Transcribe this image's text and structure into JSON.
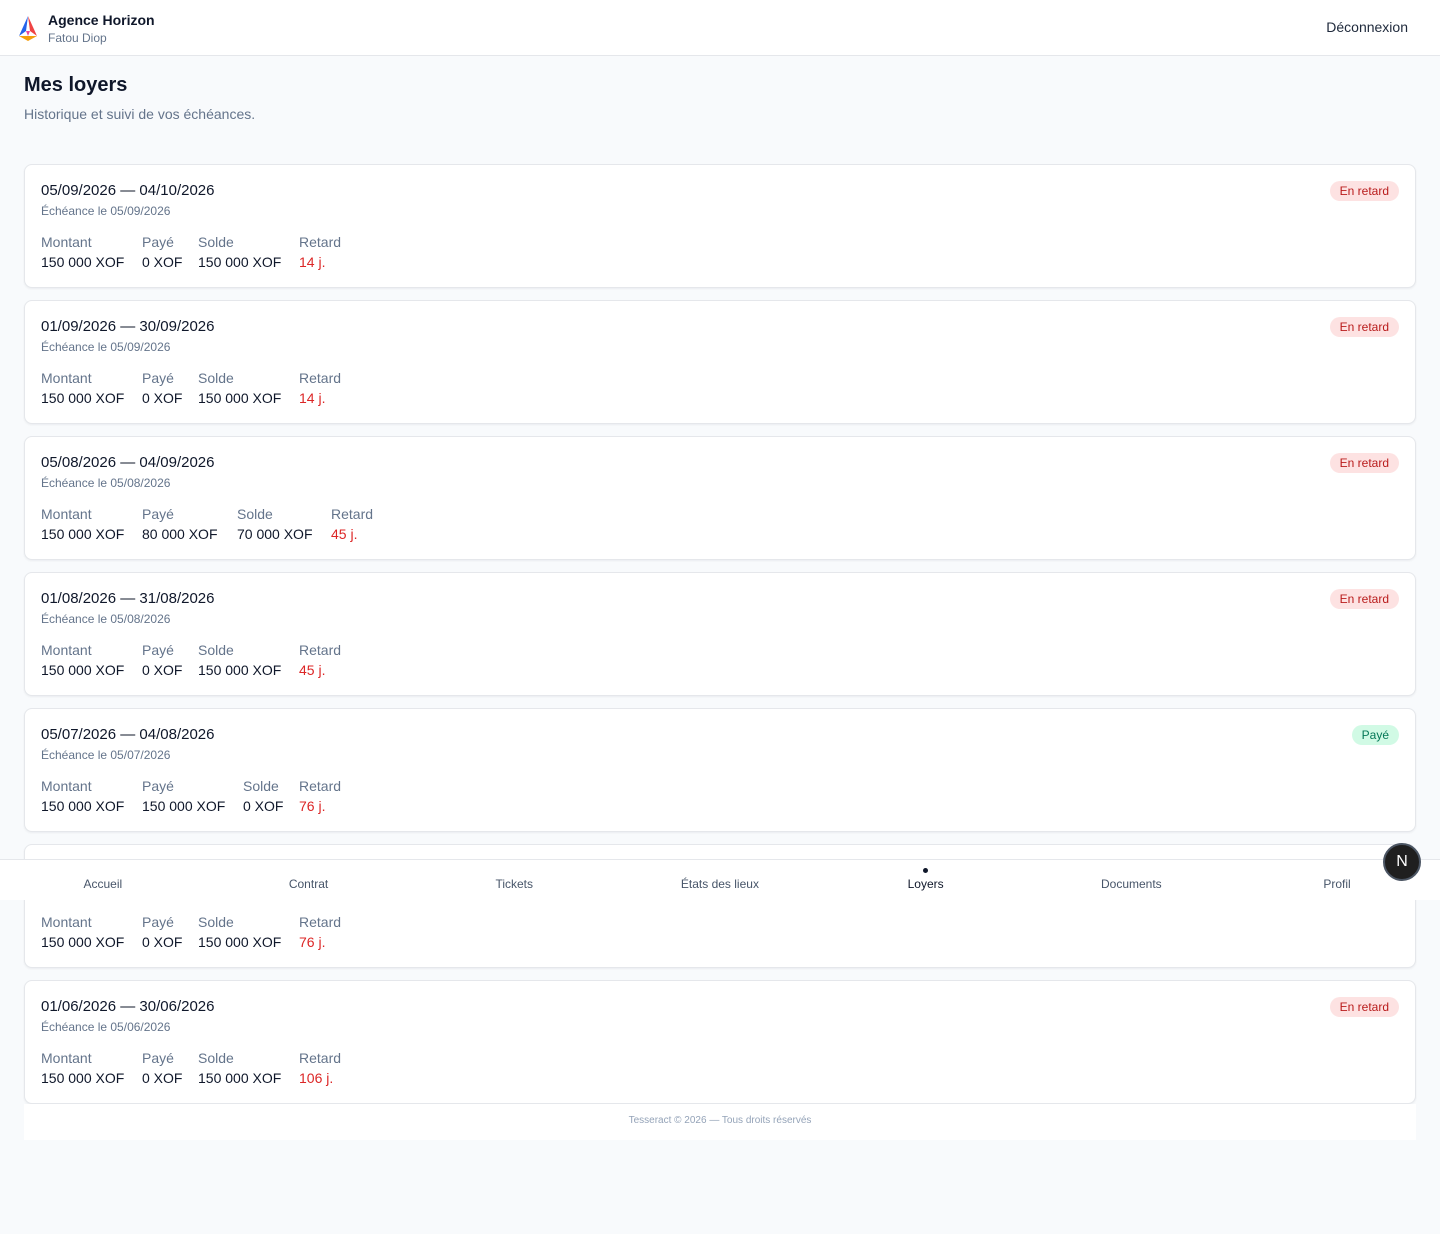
{
  "header": {
    "brand_name": "Agence Horizon",
    "user_name": "Fatou Diop",
    "logout_label": "Déconnexion"
  },
  "page": {
    "title": "Mes loyers",
    "subtitle": "Historique et suivi de vos échéances."
  },
  "labels": {
    "amount": "Montant",
    "paid": "Payé",
    "balance": "Solde",
    "delay": "Retard"
  },
  "rents": [
    {
      "period": "05/09/2026 — 04/10/2026",
      "due": "Échéance le 05/09/2026",
      "status": "En retard",
      "amount": "150 000 XOF",
      "paid": "0 XOF",
      "balance": "150 000 XOF",
      "delay": "14 j."
    },
    {
      "period": "01/09/2026 — 30/09/2026",
      "due": "Échéance le 05/09/2026",
      "status": "En retard",
      "amount": "150 000 XOF",
      "paid": "0 XOF",
      "balance": "150 000 XOF",
      "delay": "14 j."
    },
    {
      "period": "05/08/2026 — 04/09/2026",
      "due": "Échéance le 05/08/2026",
      "status": "En retard",
      "amount": "150 000 XOF",
      "paid": "80 000 XOF",
      "balance": "70 000 XOF",
      "delay": "45 j."
    },
    {
      "period": "01/08/2026 — 31/08/2026",
      "due": "Échéance le 05/08/2026",
      "status": "En retard",
      "amount": "150 000 XOF",
      "paid": "0 XOF",
      "balance": "150 000 XOF",
      "delay": "45 j."
    },
    {
      "period": "05/07/2026 — 04/08/2026",
      "due": "Échéance le 05/07/2026",
      "status": "Payé",
      "amount": "150 000 XOF",
      "paid": "150 000 XOF",
      "balance": "0 XOF",
      "delay": "76 j."
    },
    {
      "amount": "150 000 XOF",
      "paid": "0 XOF",
      "balance": "150 000 XOF",
      "delay": "76 j."
    },
    {
      "period": "01/06/2026 — 30/06/2026",
      "due": "Échéance le 05/06/2026",
      "status": "En retard",
      "amount": "150 000 XOF",
      "paid": "0 XOF",
      "balance": "150 000 XOF",
      "delay": "106 j."
    }
  ],
  "nav": {
    "items": [
      "Accueil",
      "Contrat",
      "Tickets",
      "États des lieux",
      "Loyers",
      "Documents",
      "Profil"
    ],
    "active": "Loyers"
  },
  "fab_label": "N",
  "footer": {
    "text": "Tesseract © 2026 — Tous droits réservés"
  },
  "colors": {
    "late_bg": "#fde2e2",
    "late_text": "#b91c1c",
    "paid_bg": "#d1fae5",
    "paid_text": "#047857",
    "delay_text": "#dc2626"
  },
  "icons": {
    "logo": "brand-logo-icon",
    "fab": "next-badge-icon"
  }
}
